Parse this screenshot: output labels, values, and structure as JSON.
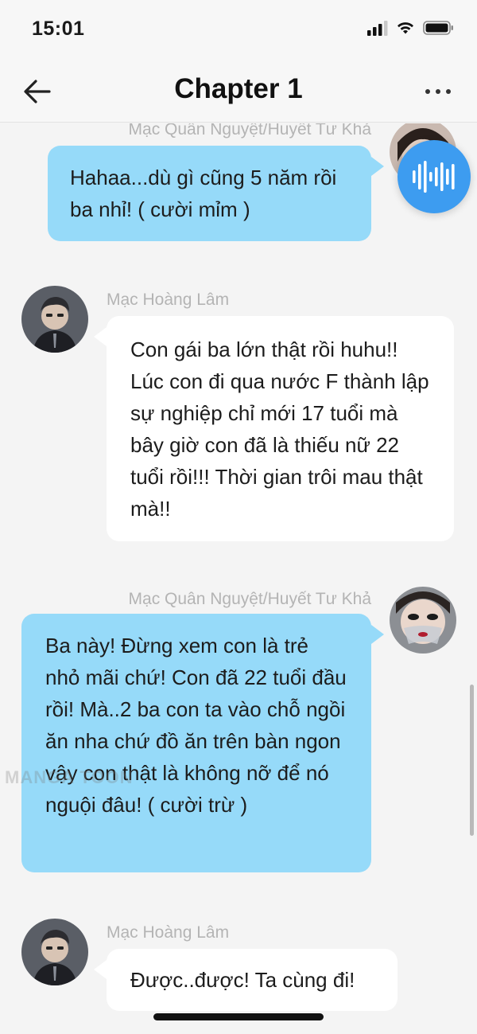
{
  "status_bar": {
    "time": "15:01"
  },
  "header": {
    "title": "Chapter 1"
  },
  "messages": [
    {
      "sender": "Mạc Quân Nguyệt/Huyết Tư Khả",
      "side": "right",
      "text": "Hahaa...dù gì cũng 5 năm rồi ba nhỉ! ( cười mỉm )"
    },
    {
      "sender": "Mạc Hoàng Lâm",
      "side": "left",
      "text": "Con gái ba lớn thật rồi huhu!! Lúc con đi qua nước F thành lập sự nghiệp chỉ mới 17 tuổi mà bây giờ con đã là thiếu nữ 22 tuổi rồi!!! Thời gian trôi mau thật mà!!"
    },
    {
      "sender": "Mạc Quân Nguyệt/Huyết Tư Khả",
      "side": "right",
      "text": "Ba này! Đừng xem con là trẻ nhỏ mãi chứ! Con đã 22 tuổi đầu rồi! Mà..2 ba con ta vào chỗ ngồi ăn nha chứ đồ ăn trên bàn ngon vậy con thật là không nỡ để nó nguội đâu! ( cười trừ )"
    },
    {
      "sender": "Mạc Hoàng Lâm",
      "side": "left",
      "text": "Được..được! Ta cùng đi!"
    }
  ],
  "watermark": "MANGA TOON",
  "colors": {
    "right_bubble": "#96daf9",
    "left_bubble": "#ffffff",
    "voice_button": "#3d9cf0"
  }
}
